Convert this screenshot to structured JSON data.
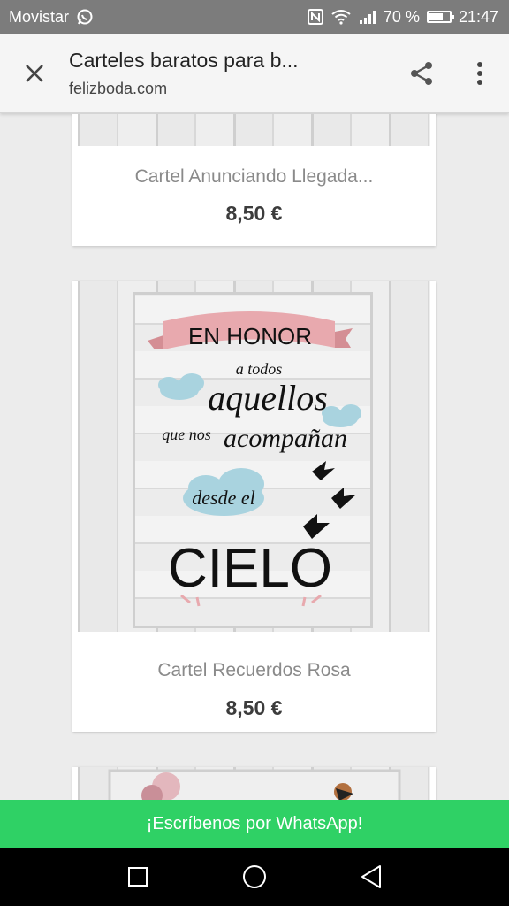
{
  "status_bar": {
    "carrier": "Movistar",
    "battery": "70 %",
    "battery_level": 0.7,
    "time": "21:47"
  },
  "toolbar": {
    "title": "Carteles baratos para b...",
    "url": "felizboda.com"
  },
  "products": [
    {
      "name": "Cartel Anunciando Llegada...",
      "price": "8,50 €"
    },
    {
      "name": "Cartel Recuerdos Rosa",
      "price": "8,50 €",
      "poster_text": {
        "line1": "EN HONOR",
        "line2": "a todos",
        "line3": "aquellos",
        "line4": "que nos",
        "line5": "acompañan",
        "line6": "desde el",
        "line7": "CIELO"
      }
    }
  ],
  "whatsapp_label": "¡Escríbenos por WhatsApp!",
  "colors": {
    "status_bar": "#7c7c7c",
    "whatsapp": "#2fd165",
    "banner_pink": "#e8a9ae",
    "cloud_blue": "#a9d3df"
  }
}
